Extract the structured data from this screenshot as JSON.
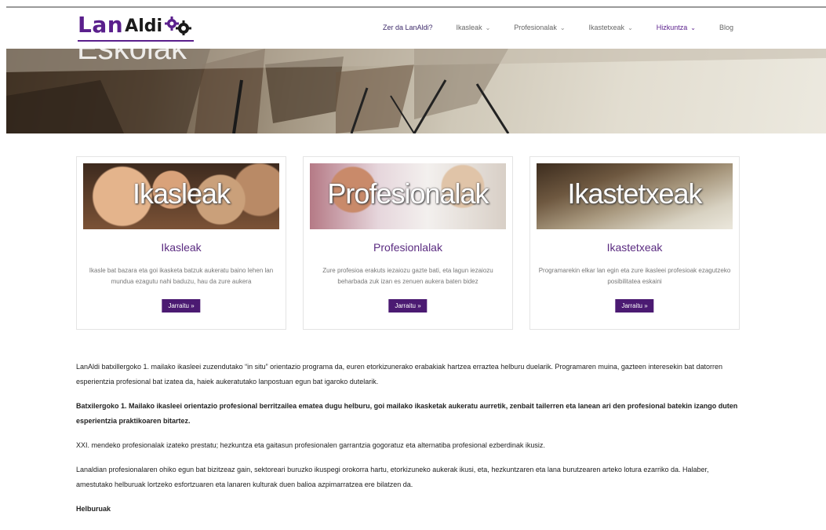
{
  "brand": {
    "logo_lan": "Lan",
    "logo_aldi": "Aldi"
  },
  "nav": [
    {
      "label": "Zer da LanAldi?",
      "has_chevron": false
    },
    {
      "label": "Ikasleak",
      "has_chevron": true
    },
    {
      "label": "Profesionalak",
      "has_chevron": true
    },
    {
      "label": "Ikastetxeak",
      "has_chevron": true
    },
    {
      "label": "Hizkuntza",
      "has_chevron": true
    },
    {
      "label": "Blog",
      "has_chevron": false
    }
  ],
  "hero": {
    "title": "Eskolak"
  },
  "cards": [
    {
      "image_text": "Ikasleak",
      "title": "Ikasleak",
      "text": "Ikasle bat bazara eta goi ikasketa batzuk aukeratu baino lehen lan mundua ezagutu nahi baduzu, hau da zure aukera",
      "button": "Jarraitu »"
    },
    {
      "image_text": "Profesionalak",
      "title": "Profesionlalak",
      "text": "Zure profesioa erakuts iezaiozu gazte bati, eta lagun iezaiozu beharbada zuk izan es zenuen aukera baten bidez",
      "button": "Jarraitu »"
    },
    {
      "image_text": "Ikastetxeak",
      "title": "Ikastetxeak",
      "text": "Programarekin elkar lan egin eta zure ikasleei profesioak ezagutzeko posibilitatea eskaini",
      "button": "Jarraitu »"
    }
  ],
  "content": {
    "p1": "LanAldi batxillergoko 1. mailako ikasleei zuzendutako “in situ” orientazio programa da, euren etorkizunerako erabakiak hartzea erraztea helburu duelarik. Programaren muina, gazteen interesekin bat datorren esperientzia profesional bat izatea da, haiek aukeratutako lanpostuan egun bat igaroko dutelarik.",
    "p2": "Batxilergoko 1. Mailako ikasleei orientazio profesional berritzailea ematea dugu helburu, goi mailako ikasketak aukeratu aurretik, zenbait tailerren eta lanean ari den profesional batekin izango duten esperientzia praktikoaren bitartez.",
    "p3": "XXI. mendeko profesionalak izateko prestatu; hezkuntza eta gaitasun profesionalen garrantzia gogoratuz eta alternatiba profesional ezberdinak ikusiz.",
    "p4": "Lanaldian profesionalaren ohiko egun bat bizitzeaz gain, sektoreari buruzko ikuspegi orokorra hartu, etorkizuneko aukerak ikusi, eta,  hezkuntzaren eta lana burutzearen arteko lotura ezarriko da. Halaber, amestutako helburuak lortzeko esfortzuaren eta lanaren kulturak duen balioa azpimarratzea ere bilatzen da.",
    "heading": "Helburuak"
  },
  "colors": {
    "brand_purple": "#5a1f8c",
    "button_purple": "#4b1a72"
  }
}
